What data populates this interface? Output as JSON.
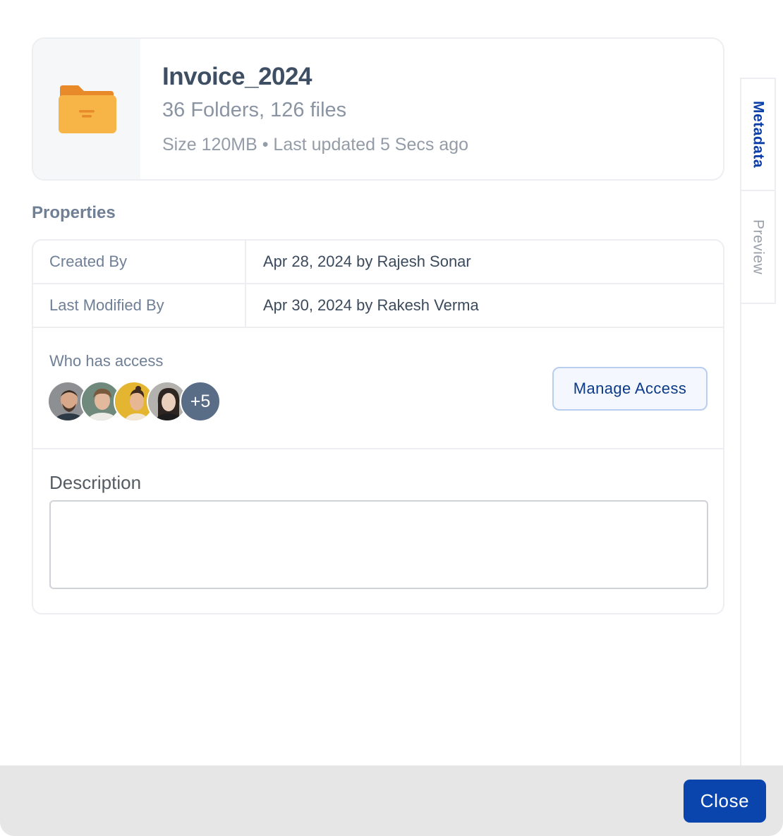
{
  "file": {
    "title": "Invoice_2024",
    "counts": "36 Folders, 126 files",
    "meta": "Size 120MB • Last updated 5 Secs ago",
    "icon": "folder-icon"
  },
  "tabs": [
    {
      "label": "Metadata",
      "active": true
    },
    {
      "label": "Preview",
      "active": false
    }
  ],
  "properties": {
    "heading": "Properties",
    "rows": [
      {
        "key": "Created By",
        "value": "Apr 28, 2024 by Rajesh Sonar"
      },
      {
        "key": "Last Modified By",
        "value": "Apr 30, 2024 by Rakesh Verma"
      }
    ],
    "access": {
      "label": "Who has access",
      "more_count": "+5",
      "manage_label": "Manage Access"
    },
    "description": {
      "label": "Description",
      "value": "",
      "placeholder": ""
    }
  },
  "footer": {
    "close_label": "Close"
  },
  "colors": {
    "primary": "#0a45ad",
    "folder": "#f7b547",
    "muted_text": "#6f7f95"
  }
}
